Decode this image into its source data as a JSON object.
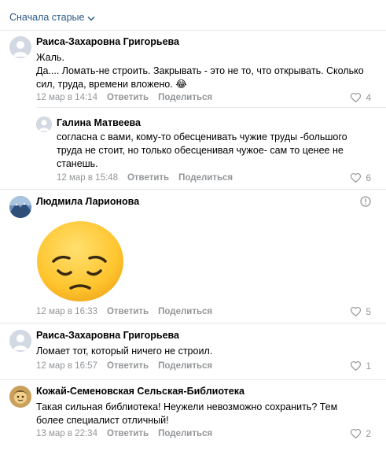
{
  "sort": {
    "label": "Сначала старые"
  },
  "comments": [
    {
      "author": "Раиса-Захаровна Григорьева",
      "lines": [
        "Жаль.",
        "Да.... Ломать-не строить. Закрывать - это не то, что открывать. Сколько",
        "сил, труда, времени вложено. 😂"
      ],
      "date": "12 мар в 14:14",
      "reply": "Ответить",
      "share": "Поделиться",
      "likes": "4"
    },
    {
      "author": "Галина Матвеева",
      "lines": [
        "согласна с вами, кому-то обесценивать чужие труды -большого",
        "труда не стоит, но только обесценивая чужое- сам то ценее не",
        "станешь."
      ],
      "date": "12 мар в 15:48",
      "reply": "Ответить",
      "share": "Поделиться",
      "likes": "6"
    },
    {
      "author": "Людмила Ларионова",
      "date": "12 мар в 16:33",
      "reply": "Ответить",
      "share": "Поделиться",
      "likes": "5",
      "sticker": "pensive-face-sticker"
    },
    {
      "author": "Раиса-Захаровна Григорьева",
      "lines": [
        "Ломает тот, который ничего не строил."
      ],
      "date": "12 мар в 16:57",
      "reply": "Ответить",
      "share": "Поделиться",
      "likes": "1"
    },
    {
      "author": "Кожай-Семеновская Сельская-Библиотека",
      "lines": [
        "Такая сильная библиотека! Неужели невозможно сохранить? Тем",
        "более специалист отличный!"
      ],
      "date": "13 мар в 22:34",
      "reply": "Ответить",
      "share": "Поделиться",
      "likes": "2"
    }
  ],
  "icons": {
    "sort": "chevron-down-icon",
    "like": "heart-icon",
    "info": "info-icon",
    "avatar_default": "default-user-avatar"
  },
  "colors": {
    "link": "#2a5885",
    "meta": "#939699",
    "divider": "#e7e8ec",
    "avatar_bg": "#d3d9e2"
  }
}
